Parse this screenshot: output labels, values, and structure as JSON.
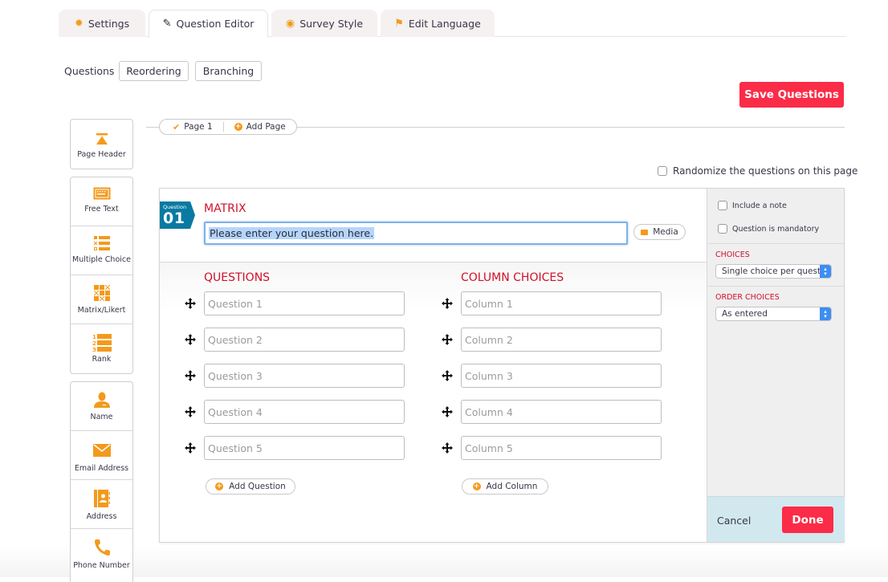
{
  "tabs": [
    {
      "label": "Settings",
      "icon": "gear-icon",
      "active": false
    },
    {
      "label": "Question Editor",
      "icon": "pencil-icon",
      "active": true
    },
    {
      "label": "Survey Style",
      "icon": "eye-icon",
      "active": false
    },
    {
      "label": "Edit Language",
      "icon": "flag-icon",
      "active": false
    }
  ],
  "subnav": {
    "label": "Questions",
    "buttons": [
      "Reordering",
      "Branching"
    ]
  },
  "save_button": "Save Questions",
  "pages": {
    "current": "Page 1",
    "add_label": "Add Page"
  },
  "randomize_label": "Randomize the questions on this page",
  "sidebar": {
    "groups": [
      [
        {
          "label": "Page Header",
          "icon": "page-header-icon"
        }
      ],
      [
        {
          "label": "Free Text",
          "icon": "keyboard-icon"
        },
        {
          "label": "Multiple Choice",
          "icon": "multiple-choice-icon"
        },
        {
          "label": "Matrix/Likert",
          "icon": "matrix-icon"
        },
        {
          "label": "Rank",
          "icon": "rank-icon"
        }
      ],
      [
        {
          "label": "Name",
          "icon": "person-icon"
        },
        {
          "label": "Email Address",
          "icon": "envelope-icon"
        },
        {
          "label": "Address",
          "icon": "address-book-icon"
        },
        {
          "label": "Phone Number",
          "icon": "phone-icon"
        }
      ]
    ]
  },
  "question": {
    "badge_small": "Question",
    "badge_number": "01",
    "type": "MATRIX",
    "text": "Please enter your question here.",
    "media_label": "Media",
    "questions_title": "QUESTIONS",
    "columns_title": "COLUMN CHOICES",
    "rows": [
      "Question 1",
      "Question 2",
      "Question 3",
      "Question 4",
      "Question 5"
    ],
    "columns": [
      "Column 1",
      "Column 2",
      "Column 3",
      "Column 4",
      "Column 5"
    ],
    "add_question_label": "Add Question",
    "add_column_label": "Add Column"
  },
  "options_panel": {
    "include_note": "Include a note",
    "mandatory": "Question is mandatory",
    "choices_label": "CHOICES",
    "choices_value": "Single choice per question",
    "order_label": "ORDER CHOICES",
    "order_value": "As entered",
    "cancel": "Cancel",
    "done": "Done"
  },
  "colors": {
    "accent": "#f39a1c",
    "primary_button": "#fb2c47",
    "section_title": "#d0112b",
    "badge": "#0a7aa2"
  }
}
